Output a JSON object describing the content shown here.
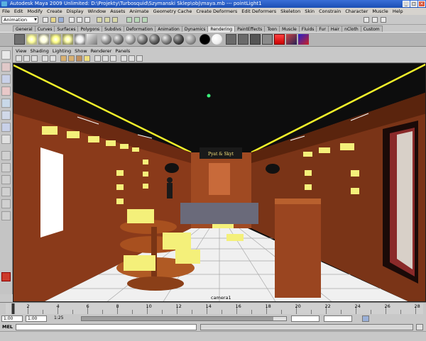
{
  "window": {
    "title": "Autodesk Maya 2009 Unlimited: D:\\Projekty\\Turbosquid\\Szymanski Sklep\\obj\\maya.mb  ---  pointLight1",
    "minimize": "_",
    "maximize": "□",
    "close": "×"
  },
  "menubar": {
    "items": [
      "File",
      "Edit",
      "Modify",
      "Create",
      "Display",
      "Window",
      "Assets",
      "Animate",
      "Geometry Cache",
      "Create Deformers",
      "Edit Deformers",
      "Skeleton",
      "Skin",
      "Constrain",
      "Character",
      "Muscle",
      "Help"
    ]
  },
  "statusline": {
    "mode": "Animation"
  },
  "shelf": {
    "tabs": [
      "General",
      "Curves",
      "Surfaces",
      "Polygons",
      "Subdivs",
      "Deformation",
      "Animation",
      "Dynamics",
      "Rendering",
      "PaintEffects",
      "Toon",
      "Muscle",
      "Fluids",
      "Fur",
      "Hair",
      "nCloth",
      "Custom"
    ],
    "active_tab": "Rendering"
  },
  "panel": {
    "menus": [
      "View",
      "Shading",
      "Lighting",
      "Show",
      "Renderer",
      "Panels"
    ],
    "camera_label": "camera1",
    "shop_sign": "Pyat & Skyt"
  },
  "timeline": {
    "ticks": [
      "2",
      "4",
      "6",
      "8",
      "10",
      "12",
      "14",
      "16",
      "18",
      "20",
      "22",
      "24",
      "26",
      "28"
    ],
    "current_frame": "1"
  },
  "range": {
    "start": "1.00",
    "playback_start": "1.00",
    "playback_end_label": "1:25"
  },
  "commandline": {
    "label": "MEL"
  },
  "colors": {
    "title_bg": "#1b4fb4",
    "wood": "#8a3a1a",
    "light_box": "#f4f07a",
    "ceiling_trim": "#f2f22a"
  }
}
